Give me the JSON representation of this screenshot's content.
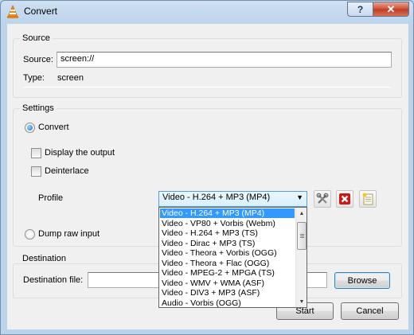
{
  "window": {
    "title": "Convert",
    "help_label": "?",
    "close_label": "✕"
  },
  "source": {
    "group_title": "Source",
    "source_label": "Source:",
    "source_value": "screen://",
    "type_label": "Type:",
    "type_value": "screen"
  },
  "settings": {
    "group_title": "Settings",
    "convert_label": "Convert",
    "display_output_label": "Display the output",
    "deinterlace_label": "Deinterlace",
    "profile_label": "Profile",
    "profile_selected": "Video - H.264 + MP3 (MP4)",
    "dump_raw_label": "Dump raw input",
    "profile_options": [
      "Video - H.264 + MP3 (MP4)",
      "Video - VP80 + Vorbis (Webm)",
      "Video - H.264 + MP3 (TS)",
      "Video - Dirac + MP3 (TS)",
      "Video - Theora + Vorbis (OGG)",
      "Video - Theora + Flac (OGG)",
      "Video - MPEG-2 + MPGA (TS)",
      "Video - WMV + WMA (ASF)",
      "Video - DIV3 + MP3 (ASF)",
      "Audio - Vorbis (OGG)"
    ]
  },
  "destination": {
    "group_title": "Destination",
    "file_label": "Destination file:",
    "file_value": "",
    "browse_label": "Browse"
  },
  "actions": {
    "start_label": "Start",
    "cancel_label": "Cancel"
  },
  "colors": {
    "selection": "#3399ff",
    "title_bar": "#bcd3ea",
    "delete_icon": "#cc1111"
  }
}
